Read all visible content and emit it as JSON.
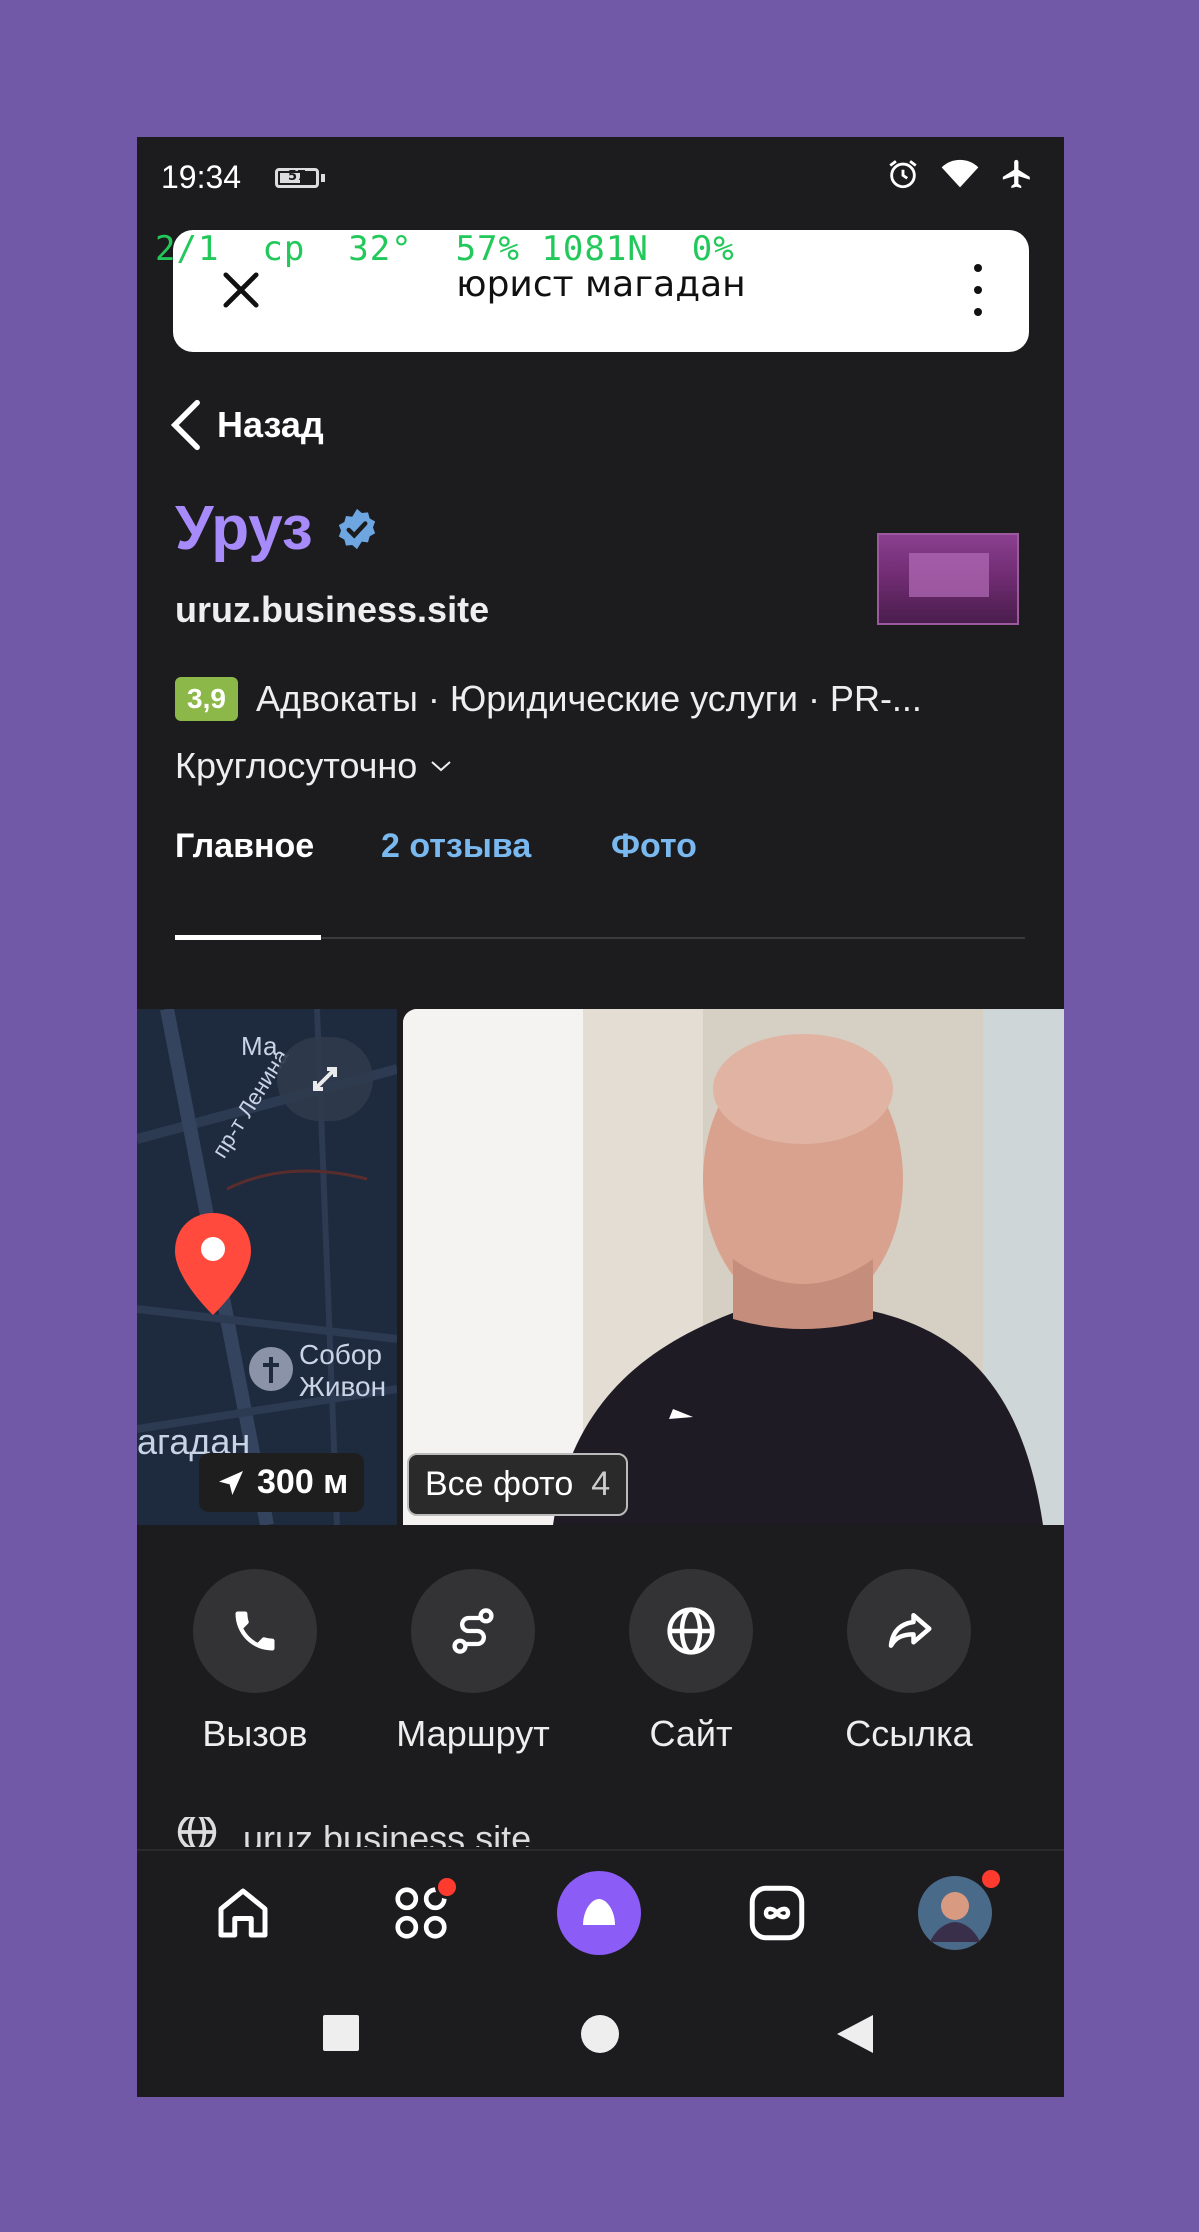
{
  "status_bar": {
    "time": "19:34",
    "battery": "57"
  },
  "overlay": {
    "stats": "2/1  ср  32°  57% 1081N  0%"
  },
  "search": {
    "query": "юрист магадан"
  },
  "nav": {
    "back_label": "Назад"
  },
  "business": {
    "name": "Уруз",
    "website": "uruz.business.site",
    "rating": "3,9",
    "categories": "Адвокаты · Юридические услуги · PR-...",
    "hours": "Круглосуточно"
  },
  "tabs": [
    {
      "label": "Главное",
      "active": true
    },
    {
      "label": "2 отзыва",
      "active": false
    },
    {
      "label": "Фото",
      "active": false
    }
  ],
  "map": {
    "label_top": "Ма",
    "label_street": "пр-т Ленина",
    "label_sobor": "Собор",
    "label_zhivon": "Живон",
    "label_city": "агадан",
    "distance": "300 м"
  },
  "photos": {
    "all_label": "Все фото",
    "count": "4"
  },
  "actions": [
    {
      "label": "Вызов",
      "icon": "phone-icon"
    },
    {
      "label": "Маршрут",
      "icon": "route-icon"
    },
    {
      "label": "Сайт",
      "icon": "globe-icon"
    },
    {
      "label": "Ссылка",
      "icon": "share-icon"
    }
  ],
  "site_row": {
    "text": "uruz.business.site"
  },
  "bottom_nav": [
    {
      "icon": "home-icon"
    },
    {
      "icon": "services-icon",
      "badge": true
    },
    {
      "icon": "alice-icon"
    },
    {
      "icon": "infinity-icon"
    },
    {
      "icon": "avatar",
      "badge": true
    }
  ],
  "colors": {
    "background": "#7259a8",
    "screen": "#1c1c1e",
    "title": "#a78bfa",
    "link": "#7ab8f0",
    "rating": "#8bb848",
    "alice": "#8b5cf6",
    "badge": "#ff3b30"
  }
}
